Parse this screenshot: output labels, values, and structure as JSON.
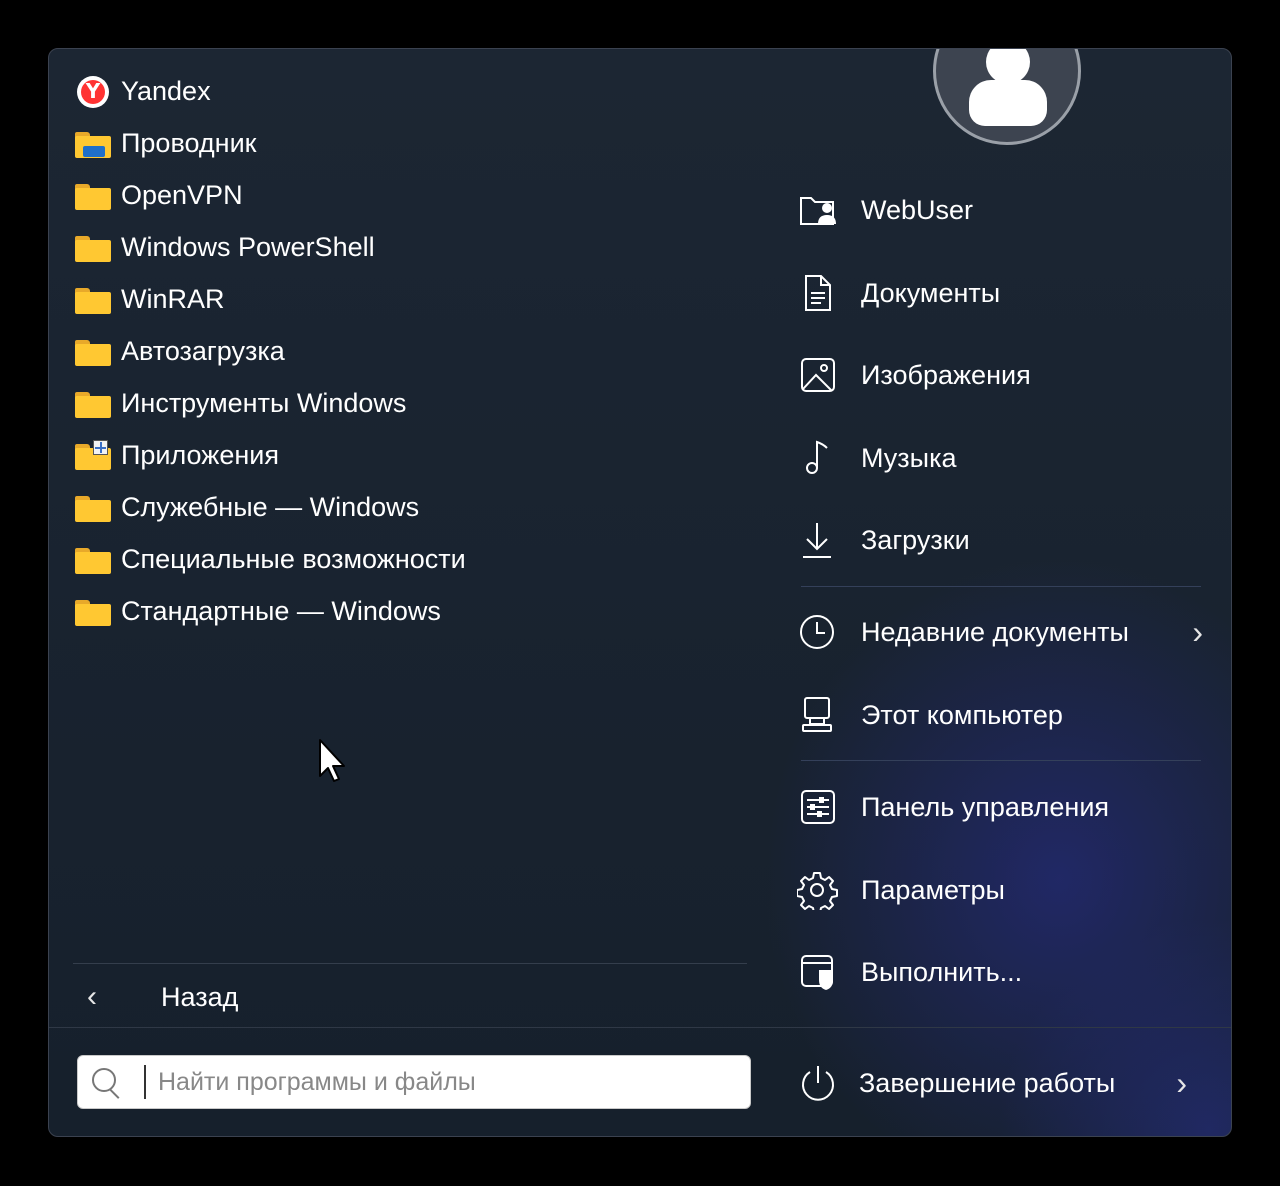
{
  "programs": [
    {
      "label": "Yandex",
      "icon": "yandex-icon"
    },
    {
      "label": "Проводник",
      "icon": "file-explorer-folder-icon"
    },
    {
      "label": "OpenVPN",
      "icon": "folder-icon"
    },
    {
      "label": "Windows PowerShell",
      "icon": "folder-icon"
    },
    {
      "label": "WinRAR",
      "icon": "folder-icon"
    },
    {
      "label": "Автозагрузка",
      "icon": "folder-icon"
    },
    {
      "label": "Инструменты Windows",
      "icon": "folder-icon"
    },
    {
      "label": "Приложения",
      "icon": "apps-folder-icon"
    },
    {
      "label": "Служебные — Windows",
      "icon": "folder-icon"
    },
    {
      "label": "Специальные возможности",
      "icon": "folder-icon"
    },
    {
      "label": "Стандартные — Windows",
      "icon": "folder-icon"
    }
  ],
  "yandex_letter": "Y",
  "back": {
    "label": "Назад",
    "chevron": "‹"
  },
  "search": {
    "placeholder": "Найти программы и файлы"
  },
  "places": [
    {
      "label": "WebUser",
      "icon": "user-folder-icon"
    },
    {
      "label": "Документы",
      "icon": "document-icon"
    },
    {
      "label": "Изображения",
      "icon": "image-icon"
    },
    {
      "label": "Музыка",
      "icon": "music-icon"
    },
    {
      "label": "Загрузки",
      "icon": "download-icon"
    },
    {
      "label": "Недавние документы",
      "icon": "clock-icon",
      "arrow": "›"
    },
    {
      "label": "Этот компьютер",
      "icon": "computer-icon"
    },
    {
      "label": "Панель управления",
      "icon": "control-panel-icon"
    },
    {
      "label": "Параметры",
      "icon": "gear-icon"
    },
    {
      "label": "Выполнить...",
      "icon": "run-icon"
    }
  ],
  "power": {
    "label": "Завершение работы",
    "arrow": "›",
    "icon": "power-icon"
  },
  "colors": {
    "folder": "#ffc832",
    "background": "#16202c",
    "accent_glow": "#242a78"
  }
}
